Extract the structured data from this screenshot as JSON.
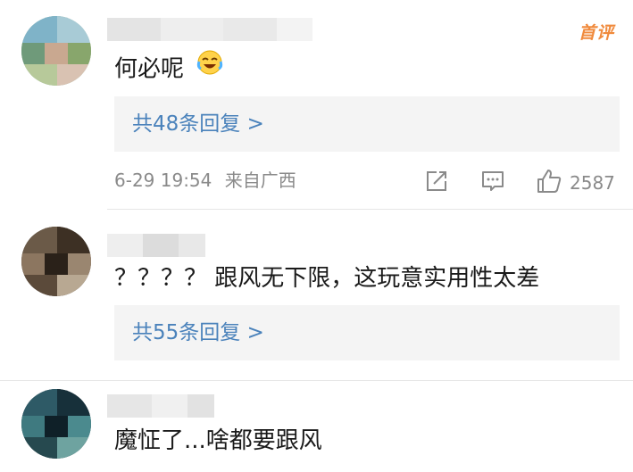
{
  "colors": {
    "link": "#4a82bb",
    "meta_text": "#8a8a8a",
    "reply_bg": "#f4f4f4",
    "badge": "#f08a3c",
    "divider": "#e6e6e6"
  },
  "comments": [
    {
      "text": "何必呢",
      "emoji": "laughing-crying-emoji",
      "badge": "首评",
      "replies_label": "共48条回复 >",
      "timestamp": "6-29 19:54",
      "source": "来自广西",
      "actions": {
        "share_icon": "share-icon",
        "comment_icon": "comment-icon",
        "like_icon": "thumbs-up-icon",
        "like_count": "2587"
      }
    },
    {
      "text": "？？？？ 跟风无下限，这玩意实用性太差",
      "replies_label": "共55条回复 >"
    },
    {
      "text": "魔怔了...啥都要跟风"
    }
  ]
}
